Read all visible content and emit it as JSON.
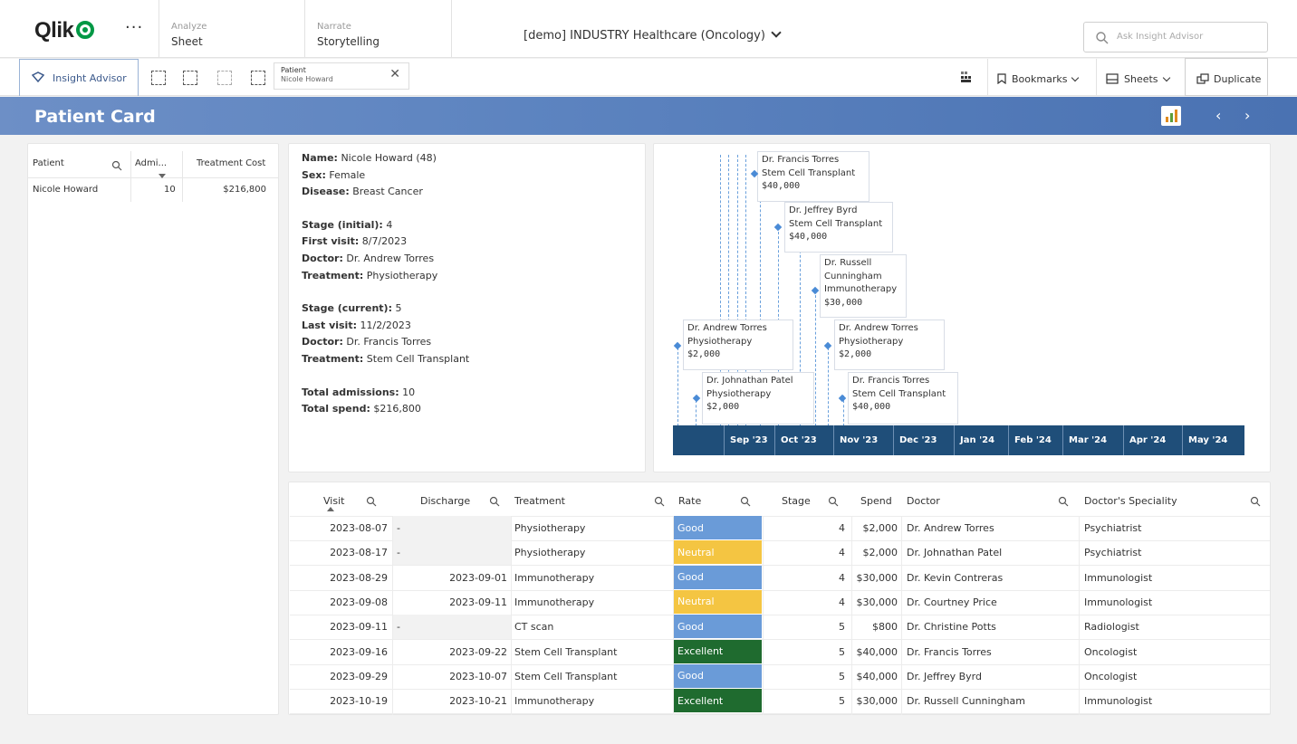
{
  "topbar": {
    "logo_text": "Qlik",
    "more_label": "···",
    "tabs": [
      {
        "sub": "Analyze",
        "main": "Sheet"
      },
      {
        "sub": "Narrate",
        "main": "Storytelling"
      }
    ],
    "app_title": "[demo] INDUSTRY Healthcare (Oncology)",
    "search_placeholder": "Ask Insight Advisor"
  },
  "toolbar": {
    "insight_advisor": "Insight Advisor",
    "selection": {
      "field": "Patient",
      "value": "Nicole Howard"
    },
    "bookmarks": "Bookmarks",
    "sheets": "Sheets",
    "duplicate": "Duplicate"
  },
  "sheet": {
    "title": "Patient Card",
    "prev": "‹",
    "next": "›"
  },
  "patient_table": {
    "headers": [
      "Patient",
      "Admi...",
      "Treatment Cost"
    ],
    "rows": [
      {
        "patient": "Nicole Howard",
        "admissions": "10",
        "cost": "$216,800"
      }
    ]
  },
  "patient_info": {
    "name_label": "Name:",
    "name": "Nicole Howard (48)",
    "sex_label": "Sex:",
    "sex": "Female",
    "disease_label": "Disease:",
    "disease": "Breast Cancer",
    "stage_initial_label": "Stage (initial):",
    "stage_initial": "4",
    "first_visit_label": "First visit:",
    "first_visit": "8/7/2023",
    "doctor1_label": "Doctor:",
    "doctor1": "Dr. Andrew Torres",
    "treatment1_label": "Treatment:",
    "treatment1": "Physiotherapy",
    "stage_current_label": "Stage (current):",
    "stage_current": "5",
    "last_visit_label": "Last visit:",
    "last_visit": "11/2/2023",
    "doctor2_label": "Doctor:",
    "doctor2": "Dr. Francis Torres",
    "treatment2_label": "Treatment:",
    "treatment2": "Stem Cell Transplant",
    "admissions_label": "Total admissions:",
    "admissions": "10",
    "spend_label": "Total spend:",
    "spend": "$216,800"
  },
  "timeline": {
    "axis_labels": [
      "Sep '23",
      "Oct '23",
      "Nov '23",
      "Dec '23",
      "Jan '24",
      "Feb '24",
      "Mar '24",
      "Apr '24",
      "May '24"
    ],
    "events": [
      {
        "doctor": "Dr. Francis Torres",
        "treatment": "Stem Cell Transplant",
        "amount": "$40,000"
      },
      {
        "doctor": "Dr. Jeffrey Byrd",
        "treatment": "Stem Cell Transplant",
        "amount": "$40,000"
      },
      {
        "doctor": "Dr. Russell Cunningham",
        "treatment": "Immunotherapy",
        "amount": "$30,000"
      },
      {
        "doctor": "Dr. Andrew Torres",
        "treatment": "Physiotherapy",
        "amount": "$2,000"
      },
      {
        "doctor": "Dr. Andrew Torres",
        "treatment": "Physiotherapy",
        "amount": "$2,000"
      },
      {
        "doctor": "Dr. Johnathan Patel",
        "treatment": "Physiotherapy",
        "amount": "$2,000"
      },
      {
        "doctor": "Dr. Francis Torres",
        "treatment": "Stem Cell Transplant",
        "amount": "$40,000"
      }
    ]
  },
  "visits_table": {
    "headers": [
      "Visit",
      "Discharge",
      "Treatment",
      "Rate",
      "Stage",
      "Spend",
      "Doctor",
      "Doctor's Speciality"
    ],
    "rows": [
      {
        "visit": "2023-08-07",
        "discharge": "-",
        "treatment": "Physiotherapy",
        "rate": "Good",
        "stage": "4",
        "spend": "$2,000",
        "doctor": "Dr. Andrew Torres",
        "speciality": "Psychiatrist"
      },
      {
        "visit": "2023-08-17",
        "discharge": "-",
        "treatment": "Physiotherapy",
        "rate": "Neutral",
        "stage": "4",
        "spend": "$2,000",
        "doctor": "Dr. Johnathan Patel",
        "speciality": "Psychiatrist"
      },
      {
        "visit": "2023-08-29",
        "discharge": "2023-09-01",
        "treatment": "Immunotherapy",
        "rate": "Good",
        "stage": "4",
        "spend": "$30,000",
        "doctor": "Dr. Kevin Contreras",
        "speciality": "Immunologist"
      },
      {
        "visit": "2023-09-08",
        "discharge": "2023-09-11",
        "treatment": "Immunotherapy",
        "rate": "Neutral",
        "stage": "4",
        "spend": "$30,000",
        "doctor": "Dr. Courtney Price",
        "speciality": "Immunologist"
      },
      {
        "visit": "2023-09-11",
        "discharge": "-",
        "treatment": "CT scan",
        "rate": "Good",
        "stage": "5",
        "spend": "$800",
        "doctor": "Dr. Christine Potts",
        "speciality": "Radiologist"
      },
      {
        "visit": "2023-09-16",
        "discharge": "2023-09-22",
        "treatment": "Stem Cell Transplant",
        "rate": "Excellent",
        "stage": "5",
        "spend": "$40,000",
        "doctor": "Dr. Francis Torres",
        "speciality": "Oncologist"
      },
      {
        "visit": "2023-09-29",
        "discharge": "2023-10-07",
        "treatment": "Stem Cell Transplant",
        "rate": "Good",
        "stage": "5",
        "spend": "$40,000",
        "doctor": "Dr. Jeffrey Byrd",
        "speciality": "Oncologist"
      },
      {
        "visit": "2023-10-19",
        "discharge": "2023-10-21",
        "treatment": "Immunotherapy",
        "rate": "Excellent",
        "stage": "5",
        "spend": "$30,000",
        "doctor": "Dr. Russell Cunningham",
        "speciality": "Immunologist"
      }
    ]
  },
  "colors": {
    "good": "#6a9bd8",
    "neutral": "#f4c542",
    "excellent": "#1f6b2f",
    "band": "#5d84c0",
    "axis": "#1f4e79",
    "brand": "#009845"
  }
}
